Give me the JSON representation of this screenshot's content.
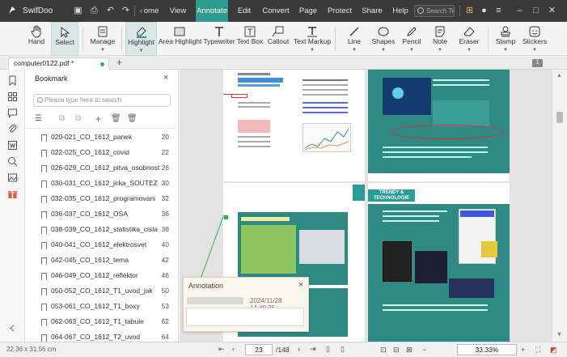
{
  "app": {
    "name": "SwifDoo",
    "colors": {
      "accent": "#2f9b8f",
      "titlebar": "#3a3a3a",
      "teal_page": "#2e8a83"
    }
  },
  "menu": {
    "left_items": [
      "ome",
      "View",
      "Annotate",
      "Edit",
      "Convert",
      "Page",
      "Protect",
      "Share",
      "Help"
    ],
    "active": "Annotate",
    "search_placeholder": "Search Te"
  },
  "ribbon": {
    "tools": [
      {
        "label": "Hand",
        "icon": "hand-icon",
        "dropdown": false,
        "selected": false
      },
      {
        "label": "Select",
        "icon": "cursor-icon",
        "dropdown": false,
        "selected": true
      },
      {
        "label": "Manage",
        "icon": "manage-icon",
        "dropdown": true,
        "selected": false
      },
      {
        "label": "Highlight",
        "icon": "highlighter-icon",
        "dropdown": true,
        "selected": true
      },
      {
        "label": "Area Highlight",
        "icon": "area-highlight-icon",
        "dropdown": false,
        "selected": false
      },
      {
        "label": "Typewriter",
        "icon": "typewriter-icon",
        "dropdown": false,
        "selected": false
      },
      {
        "label": "Text Box",
        "icon": "textbox-icon",
        "dropdown": false,
        "selected": false
      },
      {
        "label": "Callout",
        "icon": "callout-icon",
        "dropdown": false,
        "selected": false
      },
      {
        "label": "Text Markup",
        "icon": "text-markup-icon",
        "dropdown": true,
        "selected": false
      },
      {
        "label": "Line",
        "icon": "line-icon",
        "dropdown": true,
        "selected": false
      },
      {
        "label": "Shapes",
        "icon": "shapes-icon",
        "dropdown": true,
        "selected": false
      },
      {
        "label": "Pencil",
        "icon": "pencil-icon",
        "dropdown": true,
        "selected": false
      },
      {
        "label": "Note",
        "icon": "note-icon",
        "dropdown": true,
        "selected": false
      },
      {
        "label": "Eraser",
        "icon": "eraser-icon",
        "dropdown": true,
        "selected": false
      },
      {
        "label": "Stamp",
        "icon": "stamp-icon",
        "dropdown": true,
        "selected": false
      },
      {
        "label": "Stickers",
        "icon": "stickers-icon",
        "dropdown": true,
        "selected": false
      }
    ]
  },
  "tabs": {
    "document": "computer0122.pdf *",
    "add": "+",
    "page_badge": "1"
  },
  "bookmark_panel": {
    "title": "Bookmark",
    "close": "×",
    "search_placeholder": "Please type here to search",
    "items": [
      {
        "label": "020-021_CO_1612_panek",
        "page": "20"
      },
      {
        "label": "022-025_CO_1612_covid",
        "page": "22"
      },
      {
        "label": "026-029_CO_1612_pitva_osobnost",
        "page": "26"
      },
      {
        "label": "030-031_CO_1612_jirka_SOUTEZ",
        "page": "30"
      },
      {
        "label": "032-035_CO_1612_programovani",
        "page": "32"
      },
      {
        "label": "036-037_CO_1612_OSA",
        "page": "36"
      },
      {
        "label": "038-039_CO_1612_statistika_cisla",
        "page": "38"
      },
      {
        "label": "040-041_CO_1612_elektrosvet",
        "page": "40"
      },
      {
        "label": "042-045_CO_1612_tema",
        "page": "42"
      },
      {
        "label": "046-049_CO_1612_reflektor",
        "page": "46"
      },
      {
        "label": "050-052_CO_1612_T1_uvod_jak",
        "page": "50"
      },
      {
        "label": "053-061_CO_1612_T1_boxy",
        "page": "53"
      },
      {
        "label": "062-063_CO_1612_T1_tabule",
        "page": "62"
      },
      {
        "label": "064-067_CO_1612_T2_uvod",
        "page": "64"
      }
    ]
  },
  "document": {
    "trendy_banner": "TRENDY & TECHNOLOGIE"
  },
  "annotation": {
    "title": "Annotation",
    "close": "×",
    "timestamp": "2024/11/28 14:49:35"
  },
  "status": {
    "dimensions": "22.36 x 31.56 cm",
    "current_page": "23",
    "total_pages": "/148",
    "zoom": "33.33%"
  }
}
